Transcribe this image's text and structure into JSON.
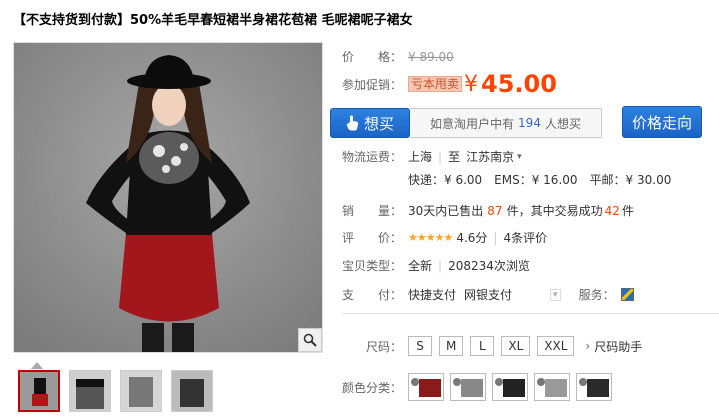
{
  "title": "【不支持货到付款】50%羊毛早春短裙半身裙花苞裙 毛呢裙呢子裙女",
  "price": {
    "label": "价　　格：",
    "original": "¥ 89.00"
  },
  "promo": {
    "label": "参加促销：",
    "tag": "亏本甩卖",
    "yen": "¥",
    "value": "45.00"
  },
  "want": {
    "button_label": "想买",
    "prefix": "如意淘用户中有",
    "count": "194",
    "suffix": "人想买"
  },
  "trend_button": "价格走向",
  "shipping": {
    "label": "物流运费：",
    "from": "上海",
    "to_prefix": "至",
    "to": "江苏南京",
    "express": "快递：¥ 6.00",
    "ems": "EMS：¥ 16.00",
    "post": "平邮：¥ 30.00"
  },
  "sales": {
    "label": "销　　量：",
    "prefix": "30天内已售出",
    "sold": "87",
    "mid": "件，其中交易成功",
    "success": "42",
    "suffix": "件"
  },
  "rating": {
    "label": "评　　价：",
    "stars": "★★★★★",
    "score": "4.6分",
    "reviews": "4条评价"
  },
  "item_type": {
    "label": "宝贝类型：",
    "condition": "全新",
    "views": "208234次浏览"
  },
  "payment": {
    "label": "支　　付：",
    "method1": "快捷支付",
    "method2": "网银支付",
    "service_label": "服务："
  },
  "sizes": {
    "label": "尺码：",
    "options": [
      "S",
      "M",
      "L",
      "XL",
      "XXL"
    ],
    "helper": "尺码助手"
  },
  "colors": {
    "label": "颜色分类：",
    "swatches": [
      "#8b1a1a",
      "#888888",
      "#222222",
      "#9a9a9a",
      "#2a2a2a"
    ]
  },
  "thumbnails": [
    "#b01818",
    "#555555",
    "#777777",
    "#333333"
  ],
  "icons": {
    "zoom": "magnifier-icon",
    "want": "hand-icon",
    "service": "service-icon"
  }
}
